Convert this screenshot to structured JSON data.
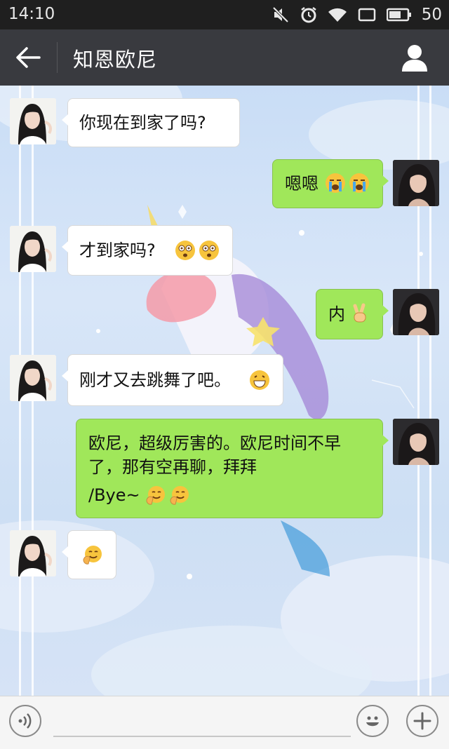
{
  "status_bar": {
    "time": "14:10",
    "battery_level": "50"
  },
  "header": {
    "title": "知恩欧尼",
    "back_icon": "arrow-left-icon",
    "profile_icon": "person-icon"
  },
  "messages": [
    {
      "from": "friend",
      "text": "你现在到家了吗?",
      "emojis": []
    },
    {
      "from": "me",
      "text": "嗯嗯",
      "emojis": [
        "crying-face",
        "crying-face"
      ]
    },
    {
      "from": "friend",
      "text": "才到家吗?",
      "emojis": [
        "dizzy-face",
        "dizzy-face"
      ]
    },
    {
      "from": "me",
      "text": "内",
      "emojis": [
        "victory-hand"
      ]
    },
    {
      "from": "friend",
      "text": "刚才又去跳舞了吧。",
      "emojis": [
        "grinning-face"
      ]
    },
    {
      "from": "me",
      "lines": [
        "欧尼，超级厉害的。欧尼时间不早",
        "了，那有空再聊，拜拜",
        "/Bye~"
      ],
      "emojis": [
        "waving-face",
        "waving-face"
      ]
    },
    {
      "from": "friend",
      "text": "",
      "emojis": [
        "waving-face"
      ]
    }
  ],
  "input_bar": {
    "placeholder": "",
    "left_icon": "voice-icon",
    "emoji_icon": "smiley-icon",
    "add_icon": "plus-icon"
  },
  "colors": {
    "header": "#393a3f",
    "status_bar": "#1f1f1f",
    "my_bubble": "#a0e75a",
    "friend_bubble": "#ffffff"
  }
}
